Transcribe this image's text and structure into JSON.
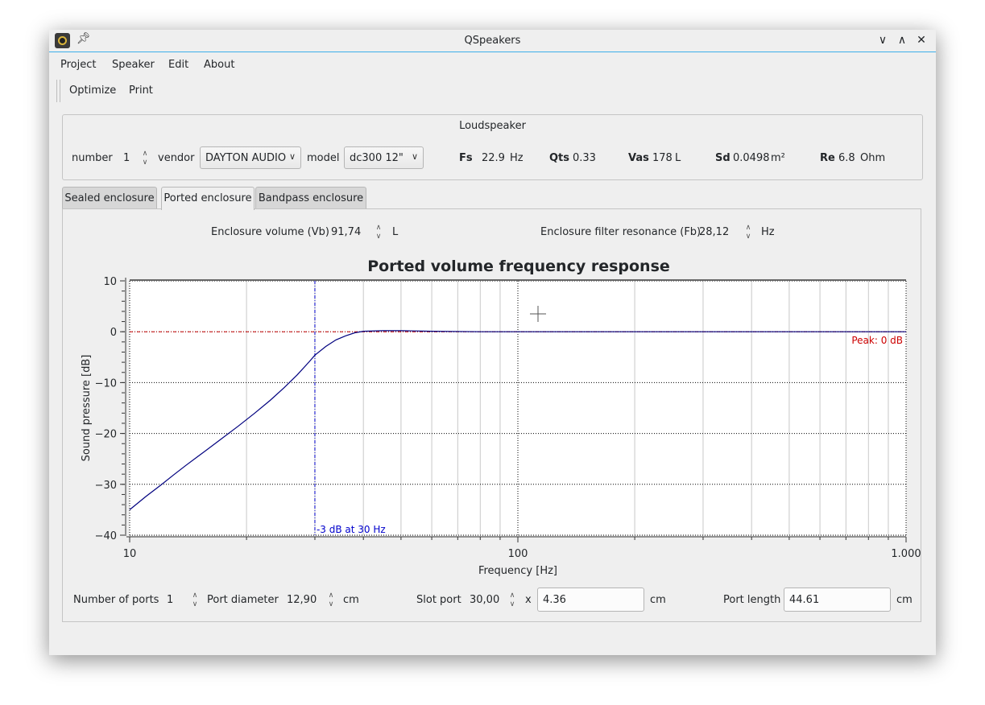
{
  "window": {
    "title": "QSpeakers",
    "controls": [
      "minimize",
      "maximize",
      "close"
    ]
  },
  "menu": [
    "Project",
    "Speaker",
    "Edit",
    "About"
  ],
  "toolbar": [
    "Optimize",
    "Print"
  ],
  "loudspeaker": {
    "title": "Loudspeaker",
    "number_label": "number",
    "number_value": "1",
    "vendor_label": "vendor",
    "vendor_value": "DAYTON AUDIO",
    "model_label": "model",
    "model_value": "dc300 12\"",
    "params": {
      "fs": {
        "name": "Fs",
        "value": "22.9",
        "unit": "Hz"
      },
      "qts": {
        "name": "Qts",
        "value": "0.33",
        "unit": ""
      },
      "vas": {
        "name": "Vas",
        "value": "178",
        "unit": "L"
      },
      "sd": {
        "name": "Sd",
        "value": "0.0498",
        "unit": "m²"
      },
      "re": {
        "name": "Re",
        "value": "6.8",
        "unit": "Ohm"
      }
    }
  },
  "tabs": [
    {
      "label": "Sealed enclosure",
      "active": false
    },
    {
      "label": "Ported enclosure",
      "active": true
    },
    {
      "label": "Bandpass enclosure",
      "active": false
    }
  ],
  "ported": {
    "vb_label": "Enclosure volume (Vb)",
    "vb_value": "91,74",
    "vb_unit": "L",
    "fb_label": "Enclosure filter resonance (Fb)",
    "fb_value": "28,12",
    "fb_unit": "Hz",
    "ports_label": "Number of ports",
    "ports_value": "1",
    "diameter_label": "Port diameter",
    "diameter_value": "12,90",
    "diameter_unit": "cm",
    "slot_label": "Slot port",
    "slot_value": "30,00",
    "slot_x": "x",
    "slot_width": "4.36",
    "slot_unit": "cm",
    "length_label": "Port length",
    "length_value": "44.61",
    "length_unit": "cm"
  },
  "chart_data": {
    "type": "line",
    "title": "Ported volume frequency response",
    "xlabel": "Frequency [Hz]",
    "ylabel": "Sound pressure [dB]",
    "x_scale": "log",
    "xlim": [
      10,
      1000
    ],
    "ylim": [
      -40,
      10
    ],
    "x_ticks": [
      10,
      100,
      1000
    ],
    "x_tick_labels": [
      "10",
      "100",
      "1.000"
    ],
    "y_ticks": [
      10,
      0,
      -10,
      -20,
      -30,
      -40
    ],
    "y_tick_labels": [
      "10",
      "0",
      "−10",
      "−20",
      "−30",
      "−40"
    ],
    "grid": true,
    "series": [
      {
        "color": "#00007f",
        "x": [
          10,
          11,
          12,
          13,
          14,
          15,
          17,
          19,
          21,
          23,
          25,
          27,
          29,
          30,
          32,
          34,
          36,
          38,
          40,
          45,
          50,
          60,
          80,
          100,
          200,
          500,
          1000
        ],
        "y": [
          -35,
          -32.4,
          -30.2,
          -28.1,
          -26.2,
          -24.5,
          -21.4,
          -18.6,
          -16.0,
          -13.5,
          -11.0,
          -8.5,
          -5.9,
          -4.6,
          -2.9,
          -1.6,
          -0.8,
          -0.2,
          0.1,
          0.2,
          0.2,
          0.1,
          0.0,
          0.0,
          0.0,
          0.0,
          0.0
        ]
      }
    ],
    "markers": [
      {
        "axis": "x",
        "value": 30,
        "color": "#0000cc",
        "style": "dashdot",
        "label": "-3 dB at 30 Hz"
      },
      {
        "axis": "y",
        "value": 0,
        "color": "#cc0000",
        "style": "dashdot",
        "label": "Peak: 0 dB"
      }
    ]
  }
}
